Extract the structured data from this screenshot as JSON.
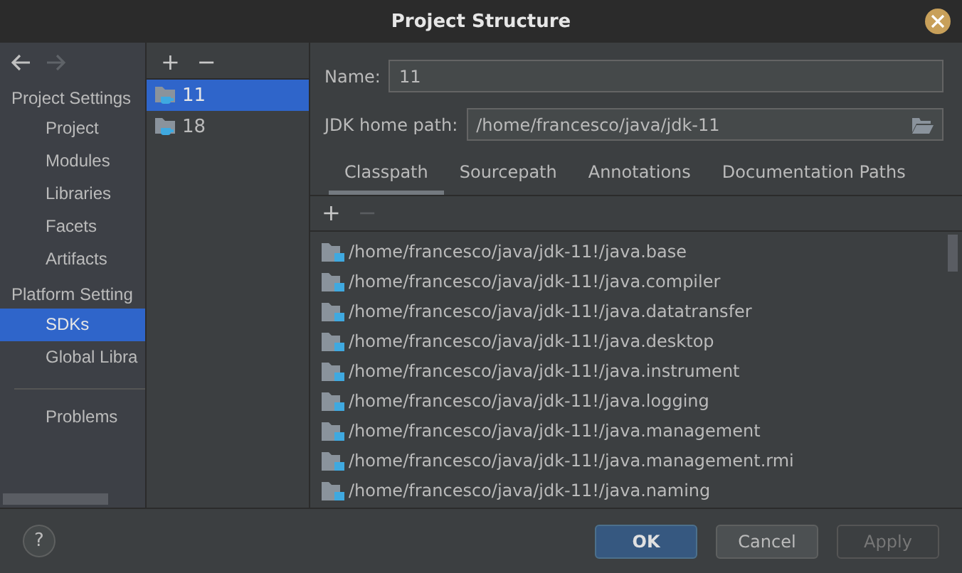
{
  "window": {
    "title": "Project Structure"
  },
  "nav": {
    "back_disabled": false,
    "forward_disabled": true
  },
  "sidebar": {
    "groups": [
      {
        "label": "Project Settings",
        "items": [
          {
            "label": "Project",
            "selected": false
          },
          {
            "label": "Modules",
            "selected": false
          },
          {
            "label": "Libraries",
            "selected": false
          },
          {
            "label": "Facets",
            "selected": false
          },
          {
            "label": "Artifacts",
            "selected": false
          }
        ]
      },
      {
        "label": "Platform Setting",
        "items": [
          {
            "label": "SDKs",
            "selected": true
          },
          {
            "label": "Global Libra",
            "selected": false
          }
        ]
      }
    ],
    "extra": [
      {
        "label": "Problems",
        "selected": false
      }
    ]
  },
  "sdk_list": {
    "add": "+",
    "remove": "−",
    "items": [
      {
        "label": "11",
        "selected": true
      },
      {
        "label": "18",
        "selected": false
      }
    ]
  },
  "form": {
    "name_label": "Name:",
    "name_value": "11",
    "home_label": "JDK home path:",
    "home_value": "/home/francesco/java/jdk-11"
  },
  "tabs": [
    {
      "label": "Classpath",
      "selected": true
    },
    {
      "label": "Sourcepath",
      "selected": false
    },
    {
      "label": "Annotations",
      "selected": false
    },
    {
      "label": "Documentation Paths",
      "selected": false
    }
  ],
  "classpath": {
    "add": "+",
    "remove": "−",
    "remove_disabled": true,
    "rows": [
      "/home/francesco/java/jdk-11!/java.base",
      "/home/francesco/java/jdk-11!/java.compiler",
      "/home/francesco/java/jdk-11!/java.datatransfer",
      "/home/francesco/java/jdk-11!/java.desktop",
      "/home/francesco/java/jdk-11!/java.instrument",
      "/home/francesco/java/jdk-11!/java.logging",
      "/home/francesco/java/jdk-11!/java.management",
      "/home/francesco/java/jdk-11!/java.management.rmi",
      "/home/francesco/java/jdk-11!/java.naming"
    ]
  },
  "footer": {
    "help": "?",
    "buttons": [
      {
        "label": "OK",
        "kind": "primary",
        "disabled": false
      },
      {
        "label": "Cancel",
        "kind": "normal",
        "disabled": false
      },
      {
        "label": "Apply",
        "kind": "normal",
        "disabled": true
      }
    ]
  }
}
